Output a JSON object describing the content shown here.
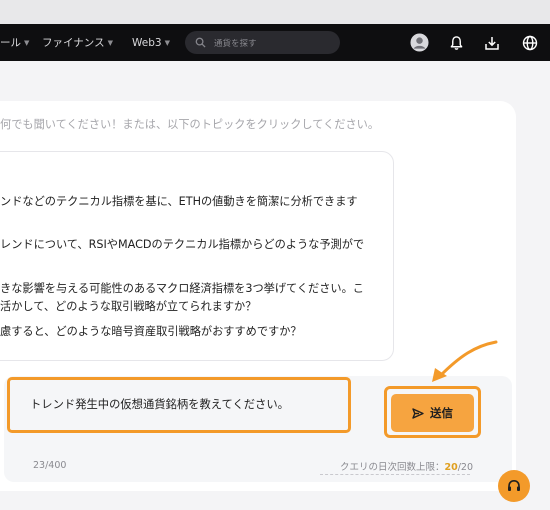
{
  "nav": {
    "items": [
      {
        "label": "ール"
      },
      {
        "label": "ファイナンス"
      },
      {
        "label": "Web3"
      }
    ],
    "search_placeholder": "通貨を探す"
  },
  "chat": {
    "hint": "何でも聞いてください！または、以下のトピックをクリックしてください。",
    "suggestions": [
      "ンドなどのテクニカル指標を基に、ETHの値動きを簡潔に分析できます",
      "レンドについて、RSIやMACDのテクニカル指標からどのような予測がで",
      "きな影響を与える可能性のあるマクロ経済指標を3つ挙げてください。こ",
      "活かして、どのような取引戦略が立てられますか？",
      "慮すると、どのような暗号資産取引戦略がおすすめですか？"
    ],
    "query": "トレンド発生中の仮想通貨銘柄を教えてください。",
    "send_label": "送信",
    "char_count": "23/400",
    "limit_label": "クエリの日次回数上限：",
    "limit_used": "20",
    "limit_total": "/20"
  },
  "colors": {
    "accent": "#f39a2a",
    "navbar": "#0e0e10"
  }
}
